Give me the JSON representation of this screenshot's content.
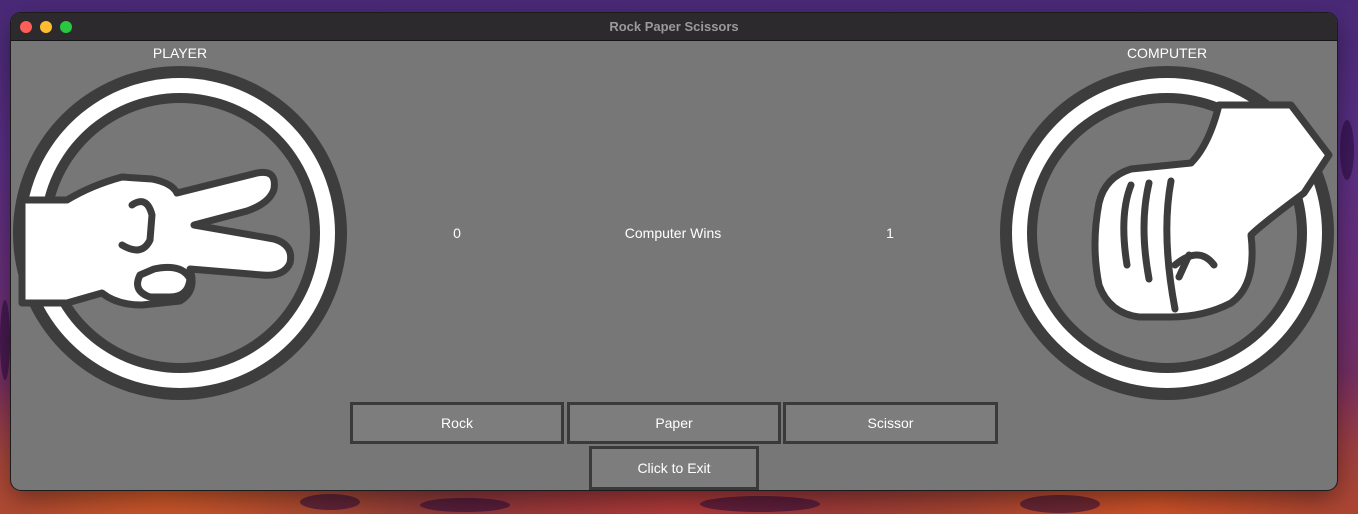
{
  "window": {
    "title": "Rock Paper Scissors",
    "traffic_lights": [
      "close",
      "minimize",
      "zoom"
    ]
  },
  "player": {
    "label": "PLAYER",
    "hand_icon": "scissors-hand-icon",
    "score": "0"
  },
  "computer": {
    "label": "COMPUTER",
    "hand_icon": "rock-fist-icon",
    "score": "1"
  },
  "status": "Computer Wins",
  "buttons": {
    "rock": "Rock",
    "paper": "Paper",
    "scissor": "Scissor",
    "exit": "Click to Exit"
  },
  "colors": {
    "window_bg": "#777777",
    "button_bg": "#7d7d7d",
    "button_border": "#3a3a3a",
    "disc_dark": "#3d3d3d",
    "disc_light": "#ffffff"
  }
}
